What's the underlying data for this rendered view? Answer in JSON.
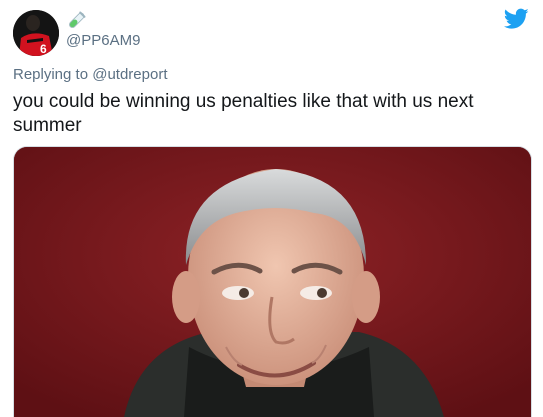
{
  "tweet": {
    "handle": "@PP6AM9",
    "replying_prefix": "Replying to ",
    "replying_to": "@utdreport",
    "text": "you could be winning us penalties like that with us next summer"
  },
  "icons": {
    "brand": "twitter-bird-icon",
    "emoji": "test-tube-emoji"
  },
  "colors": {
    "brand": "#1da1f2",
    "secondary_text": "#5b7083",
    "text": "#14171a",
    "photo_background": "#7a1a1e"
  }
}
